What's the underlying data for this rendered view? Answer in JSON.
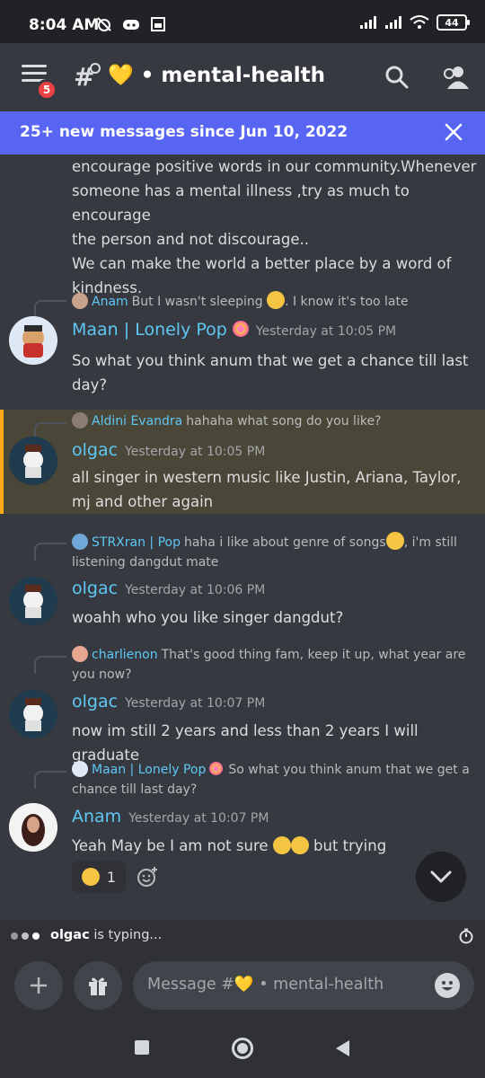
{
  "status_bar": {
    "time": "8:04 AM",
    "battery": "44"
  },
  "header": {
    "menu_badge": "5",
    "channel_title": "• mental-health"
  },
  "new_messages_bar": {
    "text": "25+ new messages since Jun 10, 2022"
  },
  "partial_message": {
    "lines": [
      "encourage positive words in our community.Whenever",
      "someone has a mental illness ,try as much to encourage",
      "the person and not discourage..",
      "We can make the world a better place by a word of",
      "kindness."
    ]
  },
  "messages": [
    {
      "reply_author": "Anam",
      "reply_text_a": "But I wasn't sleeping",
      "reply_text_b": ". I know it's too late",
      "author": "Maan | Lonely Pop",
      "timestamp": "Yesterday at 10:05 PM",
      "body": "So what you think anum that we get a chance till last day?"
    },
    {
      "reply_author": "Aldini Evandra",
      "reply_text": "hahaha what song do you like?",
      "author": "olgac",
      "timestamp": "Yesterday at 10:05 PM",
      "body": "all singer in western music like Justin, Ariana, Taylor, mj and other again"
    },
    {
      "reply_author": "STRXran | Pop",
      "reply_text_a": "haha  i like about genre of songs",
      "reply_text_b": ", i'm still listening dangdut mate",
      "author": "olgac",
      "timestamp": "Yesterday at 10:06 PM",
      "body": "woahh who you like singer dangdut?"
    },
    {
      "reply_author": "charlienon",
      "reply_text": "That's good thing fam, keep it up, what year are you now?",
      "author": "olgac",
      "timestamp": "Yesterday at 10:07 PM",
      "body": "now im still 2 years and less than 2 years I will graduate"
    },
    {
      "reply_author": "Maan | Lonely Pop",
      "reply_text": "So what you think anum that we get a chance till last day?",
      "author": "Anam",
      "timestamp": "Yesterday at 10:07 PM",
      "body_a": "Yeah May be I am not sure",
      "body_b": "but trying",
      "reaction_count": "1"
    }
  ],
  "typing": {
    "user": "olgac",
    "text": "is typing..."
  },
  "composer": {
    "placeholder": "Message #💛 • mental-health"
  },
  "colors": {
    "accent": "#5865f2",
    "username": "#5ec8f5",
    "highlight": "#faa81a",
    "badge": "#ed4245"
  }
}
